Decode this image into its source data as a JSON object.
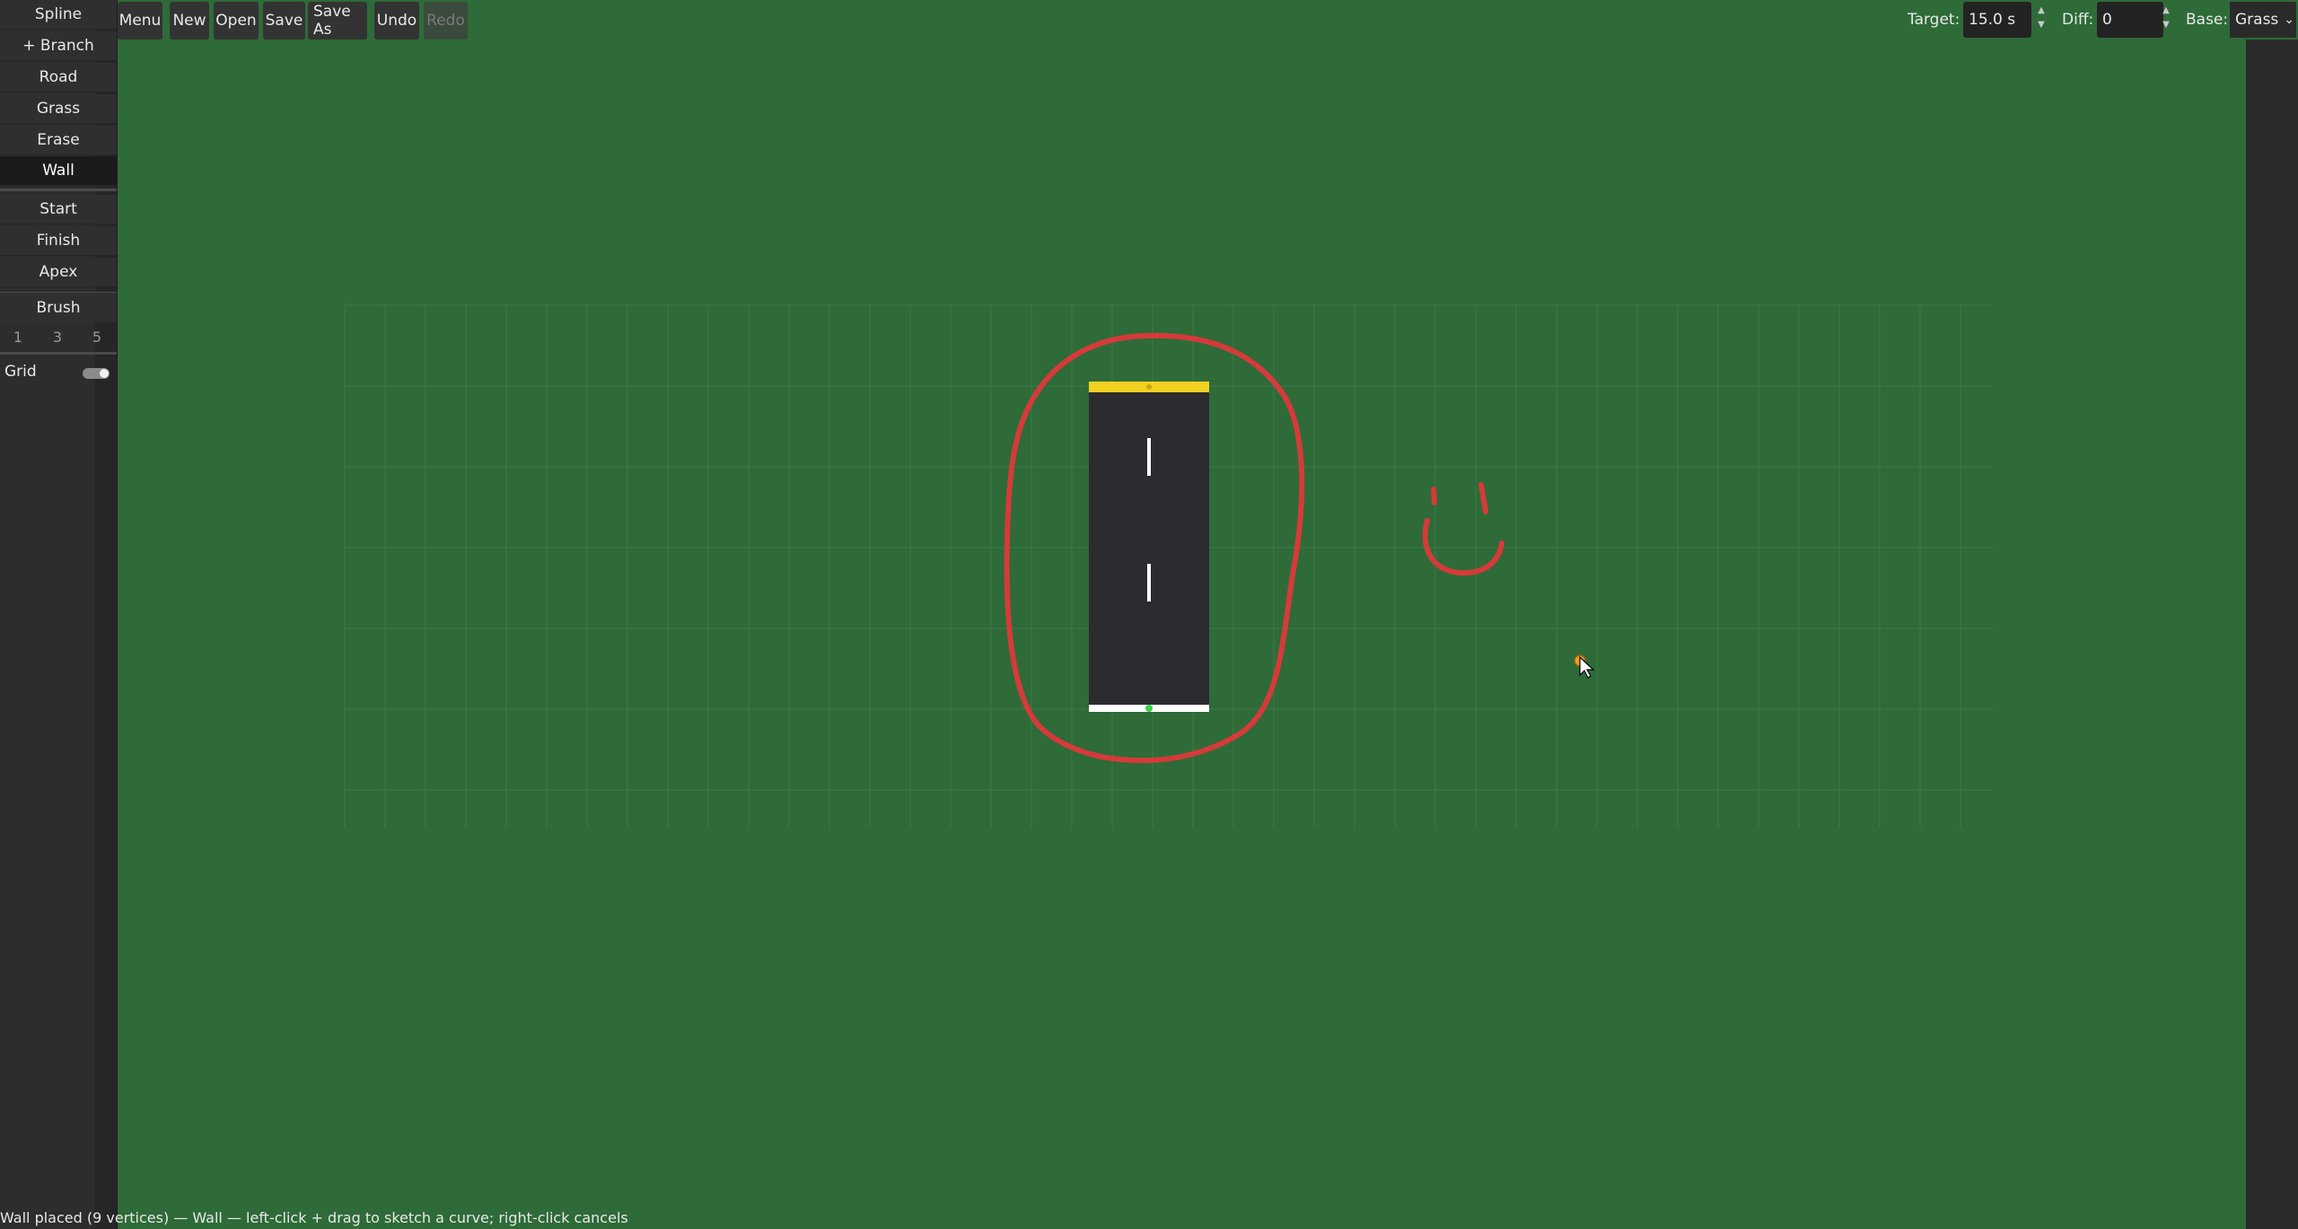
{
  "sidebar": {
    "tools": [
      {
        "label": "Spline",
        "active": false
      },
      {
        "label": "+ Branch",
        "active": false
      },
      {
        "label": "Road",
        "active": false
      },
      {
        "label": "Grass",
        "active": false
      },
      {
        "label": "Erase",
        "active": false
      },
      {
        "label": "Wall",
        "active": true
      }
    ],
    "markers": [
      {
        "label": "Start"
      },
      {
        "label": "Finish"
      },
      {
        "label": "Apex"
      }
    ],
    "brush": {
      "label": "Brush",
      "sizes": [
        "1",
        "3",
        "5"
      ]
    },
    "grid": {
      "label": "Grid",
      "enabled": true
    }
  },
  "toolbar": {
    "buttons": [
      {
        "label": "Menu",
        "enabled": true
      },
      {
        "label": "New",
        "enabled": true
      },
      {
        "label": "Open",
        "enabled": true
      },
      {
        "label": "Save",
        "enabled": true
      },
      {
        "label": "Save As",
        "enabled": true
      },
      {
        "label": "Undo",
        "enabled": true
      },
      {
        "label": "Redo",
        "enabled": false
      }
    ],
    "target": {
      "label": "Target:",
      "value": "15.0 s"
    },
    "diff": {
      "label": "Diff:",
      "value": "0"
    },
    "base": {
      "label": "Base:",
      "value": "Grass"
    }
  },
  "status": {
    "text": "Wall placed (9 vertices) — Wall — left-click + drag to sketch a curve; right-click cancels"
  },
  "colors": {
    "background": "#2e6b38",
    "grid_line": "#3f7a48",
    "road": "#2b2b30",
    "finish_line": "#f0d020",
    "start_line": "#ffffff",
    "wall": "#d63a3a",
    "cursor_marker": "#f0a020"
  }
}
